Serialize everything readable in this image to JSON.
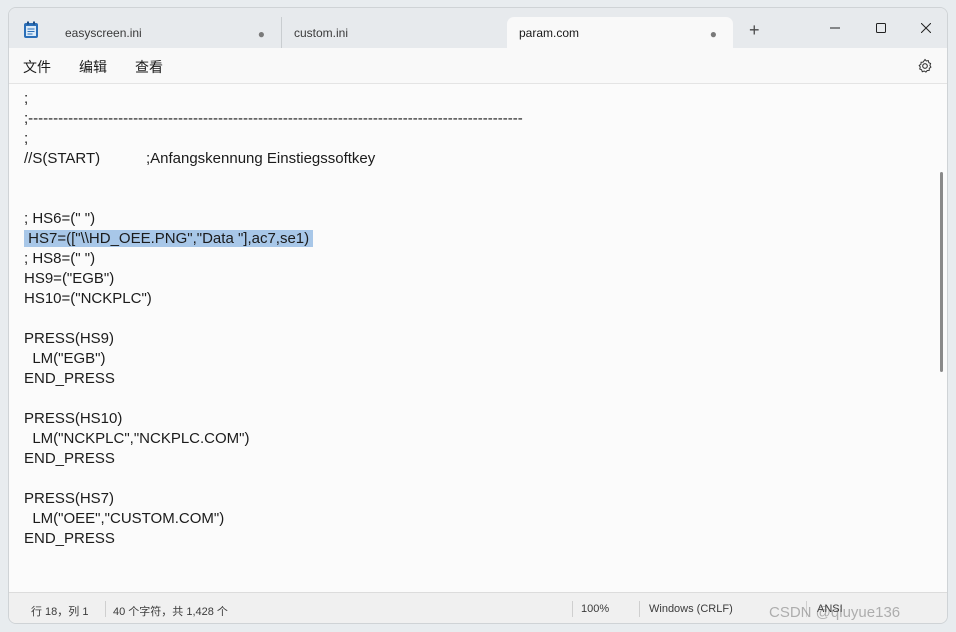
{
  "tabs": [
    {
      "label": "easyscreen.ini",
      "modified": "●"
    },
    {
      "label": "custom.ini",
      "modified": ""
    },
    {
      "label": "param.com",
      "modified": "●"
    }
  ],
  "new_tab": "+",
  "menu": {
    "file": "文件",
    "edit": "编辑",
    "view": "查看"
  },
  "editor": {
    "lines": [
      ";",
      ";---------------------------------------------------------------------------------------------------",
      ";",
      "//S(START)           ;Anfangskennung Einstiegssoftkey",
      "",
      "",
      "; HS6=(\" \")",
      " HS7=([\"\\\\HD_OEE.PNG\",\"Data \"],ac7,se1) ",
      "; HS8=(\" \")",
      "HS9=(\"EGB\")",
      "HS10=(\"NCKPLC\")",
      "",
      "PRESS(HS9)",
      "  LM(\"EGB\")",
      "END_PRESS",
      "",
      "PRESS(HS10)",
      "  LM(\"NCKPLC\",\"NCKPLC.COM\")",
      "END_PRESS",
      "",
      "PRESS(HS7)",
      "  LM(\"OEE\",\"CUSTOM.COM\")",
      "END_PRESS"
    ],
    "selected_line": 7
  },
  "status": {
    "position": "行 18，列 1",
    "chars": "40 个字符，共 1,428 个",
    "zoom": "100%",
    "line_ending": "Windows (CRLF)",
    "encoding": "ANSI"
  },
  "watermark": "CSDN @qiuyue136"
}
